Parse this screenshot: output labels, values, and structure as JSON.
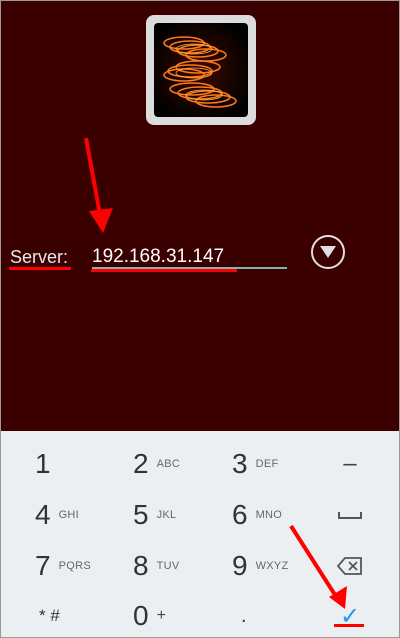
{
  "server": {
    "label": "Server:",
    "value": "192.168.31.147"
  },
  "keypad": {
    "rows": [
      [
        {
          "main": "1",
          "sub": ""
        },
        {
          "main": "2",
          "sub": "ABC"
        },
        {
          "main": "3",
          "sub": "DEF"
        }
      ],
      [
        {
          "main": "4",
          "sub": "GHI"
        },
        {
          "main": "5",
          "sub": "JKL"
        },
        {
          "main": "6",
          "sub": "MNO"
        }
      ],
      [
        {
          "main": "7",
          "sub": "PQRS"
        },
        {
          "main": "8",
          "sub": "TUV"
        },
        {
          "main": "9",
          "sub": "WXYZ"
        }
      ],
      [
        {
          "main": "* #",
          "sub": ""
        },
        {
          "main": "0",
          "sub": "+"
        },
        {
          "main": ".",
          "sub": ""
        }
      ]
    ],
    "minus": "–",
    "done_icon": "✓"
  },
  "icons": {
    "app": "spring-coil-icon",
    "dropdown": "triangle-down-icon",
    "space": "space-bar-icon",
    "backspace": "backspace-icon",
    "done": "checkmark-icon"
  },
  "colors": {
    "background": "#3a0000",
    "keyboard": "#eceff1",
    "accent": "#7ab4bd",
    "done": "#2196f3",
    "annotation": "#ff0000"
  }
}
